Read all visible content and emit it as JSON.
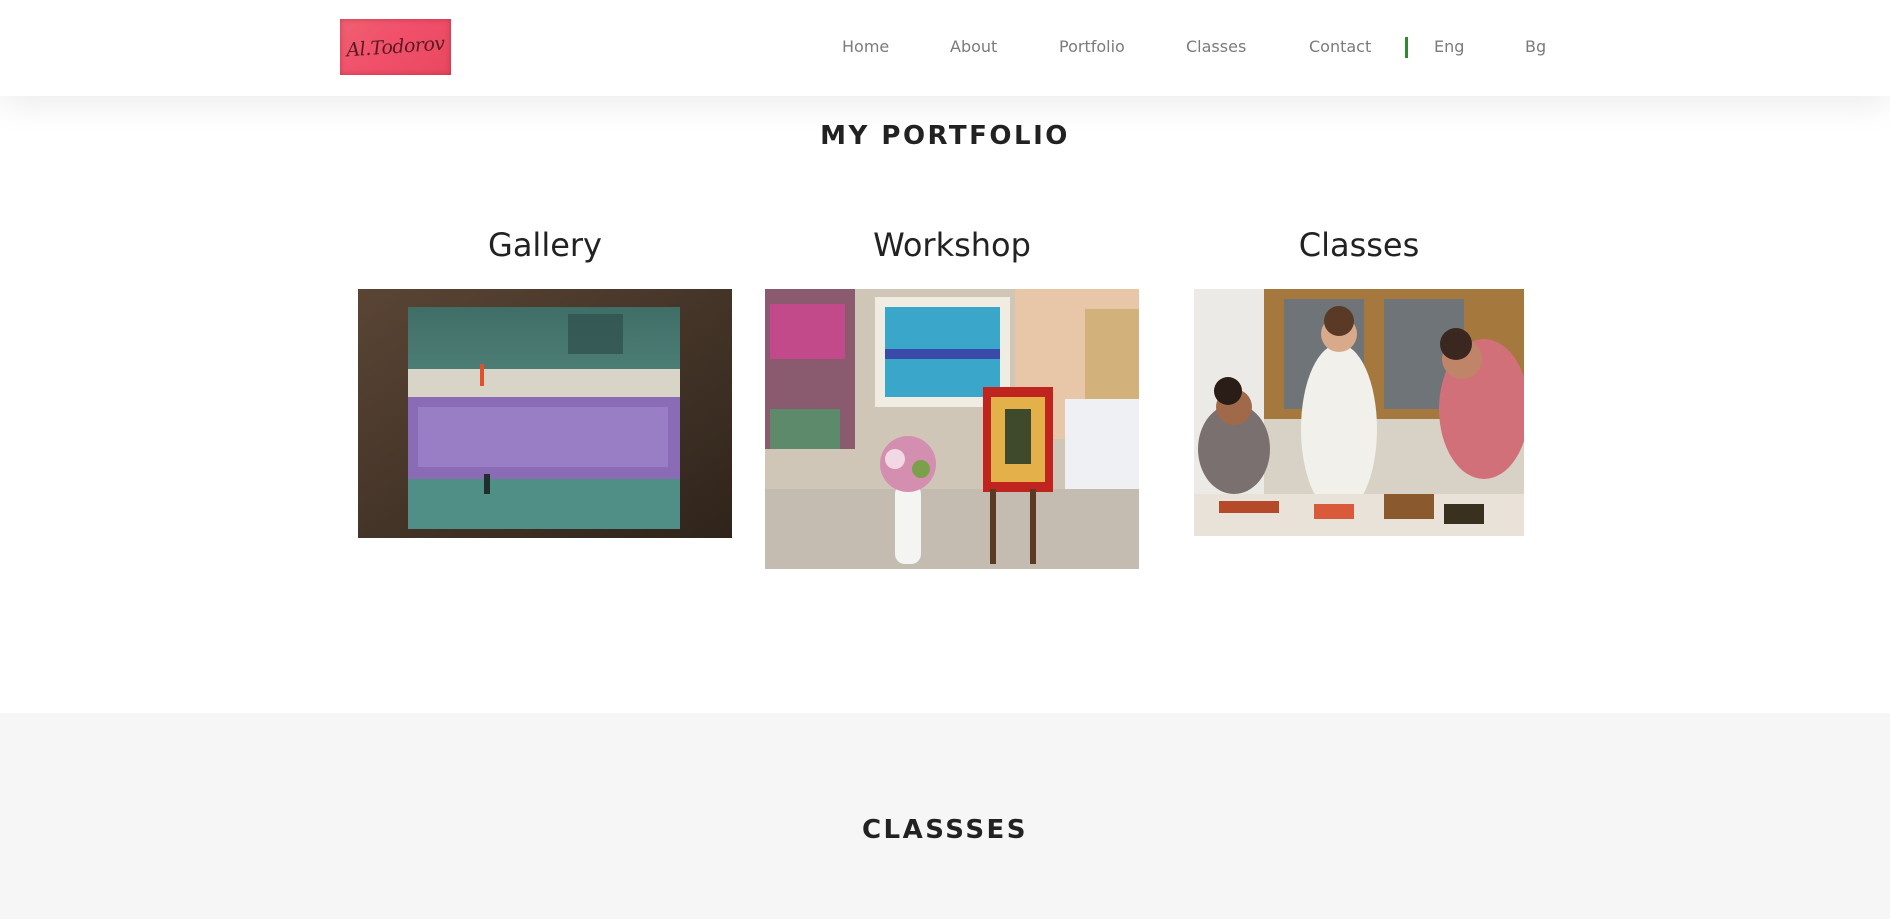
{
  "header": {
    "logo_text": "Al.Todorov",
    "nav": [
      {
        "label": "Home"
      },
      {
        "label": "About"
      },
      {
        "label": "Portfolio"
      },
      {
        "label": "Classes"
      },
      {
        "label": "Contact"
      }
    ],
    "languages": [
      {
        "label": "Eng"
      },
      {
        "label": "Bg"
      }
    ],
    "divider_color": "#2e8b2e"
  },
  "portfolio": {
    "title": "MY PORTFOLIO",
    "cards": [
      {
        "title": "Gallery",
        "image": "abstract-painting-image"
      },
      {
        "title": "Workshop",
        "image": "workshop-image"
      },
      {
        "title": "Classes",
        "image": "classes-image"
      }
    ]
  },
  "classes_section": {
    "title": "CLASSSES"
  }
}
